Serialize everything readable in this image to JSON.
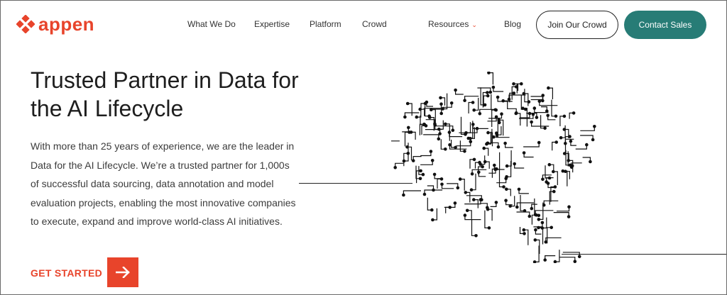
{
  "brand": {
    "name": "appen",
    "accent": "#e8442b",
    "teal": "#277c76"
  },
  "nav": {
    "items": [
      "What We Do",
      "Expertise",
      "Platform",
      "Crowd",
      "Resources",
      "Blog"
    ],
    "join_label": "Join Our Crowd",
    "contact_label": "Contact Sales"
  },
  "hero": {
    "title": "Trusted Partner in Data for the AI Lifecycle",
    "description": "With more than 25 years of experience, we are the leader in Data for the AI Lifecycle. We’re a trusted partner for 1,000s of successful data sourcing, data annotation and model evaluation projects, enabling the most innovative companies to execute, expand and improve world-class AI initiatives.",
    "cta_label": "GET STARTED"
  },
  "icons": {
    "logo": "diamond-cluster-icon",
    "resources_caret": "chevron-down-icon",
    "cta": "arrow-right-icon",
    "illustration": "circuit-brain-icon"
  }
}
